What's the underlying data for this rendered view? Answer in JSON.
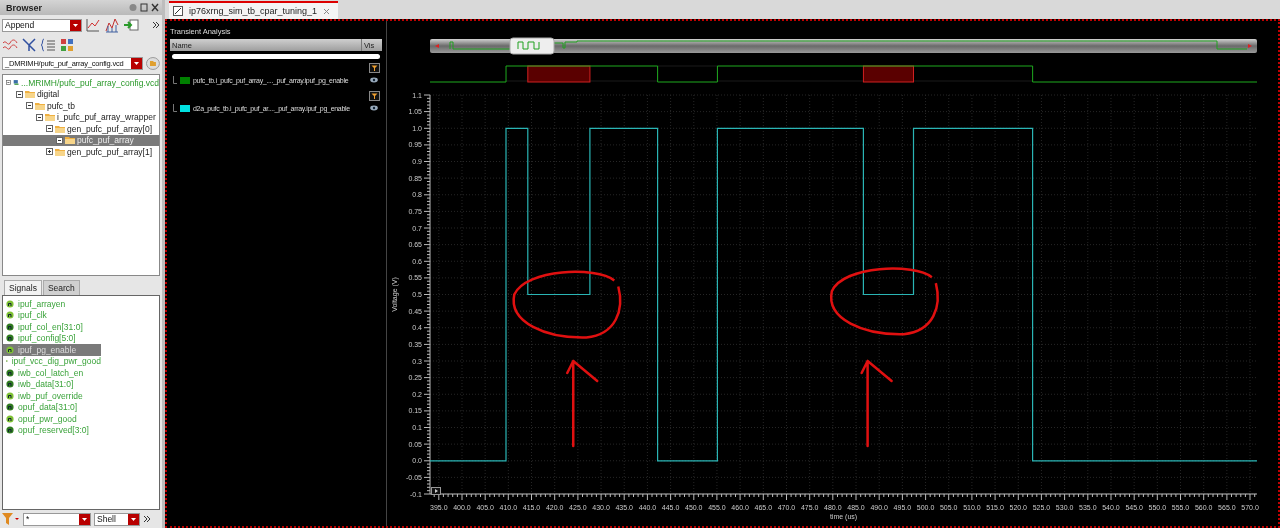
{
  "browser": {
    "title": "Browser",
    "mode_select": {
      "value": "Append"
    },
    "path_select": {
      "value": "_DMRIMH/pufc_puf_array_config.vcd"
    },
    "tree": [
      {
        "label": "...MRIMH/pufc_puf_array_config.vcd",
        "kind": "file",
        "expanded": true,
        "selected": false,
        "children": [
          {
            "label": "digital",
            "kind": "folder",
            "expanded": true,
            "selected": false,
            "children": [
              {
                "label": "pufc_tb",
                "kind": "folder",
                "expanded": true,
                "selected": false,
                "children": [
                  {
                    "label": "i_pufc_puf_array_wrapper",
                    "kind": "folder",
                    "expanded": true,
                    "selected": false,
                    "children": [
                      {
                        "label": "gen_pufc_puf_array[0]",
                        "kind": "folder",
                        "expanded": true,
                        "selected": false,
                        "children": [
                          {
                            "label": "pufc_puf_array",
                            "kind": "folder",
                            "expanded": true,
                            "selected": true
                          }
                        ]
                      },
                      {
                        "label": "gen_pufc_puf_array[1]",
                        "kind": "folder",
                        "expanded": false,
                        "selected": false
                      }
                    ]
                  }
                ]
              }
            ]
          }
        ]
      }
    ],
    "signal_tabs": [
      {
        "label": "Signals",
        "selected": true
      },
      {
        "label": "Search",
        "selected": false
      }
    ],
    "signals": [
      {
        "name": "ipuf_arrayen",
        "kind": "wire",
        "selected": false
      },
      {
        "name": "ipuf_clk",
        "kind": "wire",
        "selected": false
      },
      {
        "name": "ipuf_col_en[31:0]",
        "kind": "bus",
        "selected": false
      },
      {
        "name": "ipuf_config[5:0]",
        "kind": "bus",
        "selected": false
      },
      {
        "name": "ipuf_pg_enable",
        "kind": "wire",
        "selected": true
      },
      {
        "name": "ipuf_vcc_dig_pwr_good",
        "kind": "wire",
        "selected": false
      },
      {
        "name": "iwb_col_latch_en",
        "kind": "bus",
        "selected": false
      },
      {
        "name": "iwb_data[31:0]",
        "kind": "bus",
        "selected": false
      },
      {
        "name": "iwb_puf_override",
        "kind": "wire",
        "selected": false
      },
      {
        "name": "opuf_data[31:0]",
        "kind": "bus",
        "selected": false
      },
      {
        "name": "opuf_pwr_good",
        "kind": "wire",
        "selected": false
      },
      {
        "name": "opuf_reserved[3:0]",
        "kind": "bus",
        "selected": false
      }
    ],
    "filter": {
      "value": "*"
    },
    "scope_select": {
      "value": "Shell"
    }
  },
  "doc_tab": {
    "label": "ip76xrng_sim_tb_cpar_tuning_1",
    "selected": true
  },
  "panel_title": "Transient Analysis",
  "trace_columns": [
    "Name",
    "Vis"
  ],
  "traces": [
    {
      "name": "pufc_tb.i_pufc_puf_array_...._puf_array.ipuf_pg_enable",
      "color": "#008000"
    },
    {
      "name": "d2a_pufc_tb.i_pufc_puf_ar...._puf_array.ipuf_pg_enable",
      "color": "#00e0e0"
    }
  ],
  "chart": {
    "chart_data": {
      "type": "line",
      "xlabel": "time (us)",
      "ylabel": "Voltage (V)",
      "xlim": [
        393.1,
        571.5
      ],
      "ylim": [
        -0.1,
        1.1
      ],
      "x": [
        393.1,
        409.5,
        409.5,
        414.2,
        414.2,
        427.6,
        427.6,
        442.2,
        442.2,
        455.1,
        455.1,
        486.6,
        486.6,
        497.4,
        497.4,
        523.1,
        523.1,
        571.5
      ],
      "grid": true,
      "series": [
        {
          "color": "#2ab5b5",
          "values": [
            0,
            0,
            1,
            1,
            0.5,
            0.5,
            1,
            1,
            0,
            0,
            1,
            1,
            0.5,
            0.5,
            1,
            1,
            0,
            0
          ]
        }
      ],
      "xticks": [
        {
          "value": 395,
          "label": "395.0"
        },
        {
          "value": 400,
          "label": "400.0"
        },
        {
          "value": 405,
          "label": "405.0"
        },
        {
          "value": 410,
          "label": "410.0"
        },
        {
          "value": 415,
          "label": "415.0"
        },
        {
          "value": 420,
          "label": "420.0"
        },
        {
          "value": 425,
          "label": "425.0"
        },
        {
          "value": 430,
          "label": "430.0"
        },
        {
          "value": 435,
          "label": "435.0"
        },
        {
          "value": 440,
          "label": "440.0"
        },
        {
          "value": 445,
          "label": "445.0"
        },
        {
          "value": 450,
          "label": "450.0"
        },
        {
          "value": 455,
          "label": "455.0"
        },
        {
          "value": 460,
          "label": "460.0"
        },
        {
          "value": 465,
          "label": "465.0"
        },
        {
          "value": 470,
          "label": "470.0"
        },
        {
          "value": 475,
          "label": "475.0"
        },
        {
          "value": 480,
          "label": "480.0"
        },
        {
          "value": 485,
          "label": "485.0"
        },
        {
          "value": 490,
          "label": "490.0"
        },
        {
          "value": 495,
          "label": "495.0"
        },
        {
          "value": 500,
          "label": "500.0"
        },
        {
          "value": 505,
          "label": "505.0"
        },
        {
          "value": 510,
          "label": "510.0"
        },
        {
          "value": 515,
          "label": "515.0"
        },
        {
          "value": 520,
          "label": "520.0"
        },
        {
          "value": 525,
          "label": "525.0"
        },
        {
          "value": 530,
          "label": "530.0"
        },
        {
          "value": 535,
          "label": "535.0"
        },
        {
          "value": 540,
          "label": "540.0"
        },
        {
          "value": 545,
          "label": "545.0"
        },
        {
          "value": 550,
          "label": "550.0"
        },
        {
          "value": 555,
          "label": "555.0"
        },
        {
          "value": 560,
          "label": "560.0"
        },
        {
          "value": 565,
          "label": "565.0"
        },
        {
          "value": 570,
          "label": "570.0"
        }
      ],
      "yticks": [
        {
          "value": -0.1,
          "label": "-0.1"
        },
        {
          "value": -0.05,
          "label": "-0.05"
        },
        {
          "value": 0,
          "label": "0.0"
        },
        {
          "value": 0.05,
          "label": "0.05"
        },
        {
          "value": 0.1,
          "label": "0.1"
        },
        {
          "value": 0.15,
          "label": "0.15"
        },
        {
          "value": 0.2,
          "label": "0.2"
        },
        {
          "value": 0.25,
          "label": "0.25"
        },
        {
          "value": 0.3,
          "label": "0.3"
        },
        {
          "value": 0.35,
          "label": "0.35"
        },
        {
          "value": 0.4,
          "label": "0.4"
        },
        {
          "value": 0.45,
          "label": "0.45"
        },
        {
          "value": 0.5,
          "label": "0.5"
        },
        {
          "value": 0.55,
          "label": "0.55"
        },
        {
          "value": 0.6,
          "label": "0.6"
        },
        {
          "value": 0.65,
          "label": "0.65"
        },
        {
          "value": 0.7,
          "label": "0.7"
        },
        {
          "value": 0.75,
          "label": "0.75"
        },
        {
          "value": 0.8,
          "label": "0.8"
        },
        {
          "value": 0.85,
          "label": "0.85"
        },
        {
          "value": 0.9,
          "label": "0.9"
        },
        {
          "value": 0.95,
          "label": "0.95"
        },
        {
          "value": 1,
          "label": "1.0"
        },
        {
          "value": 1.05,
          "label": "1.05"
        },
        {
          "value": 1.1,
          "label": "1.1"
        }
      ]
    }
  }
}
